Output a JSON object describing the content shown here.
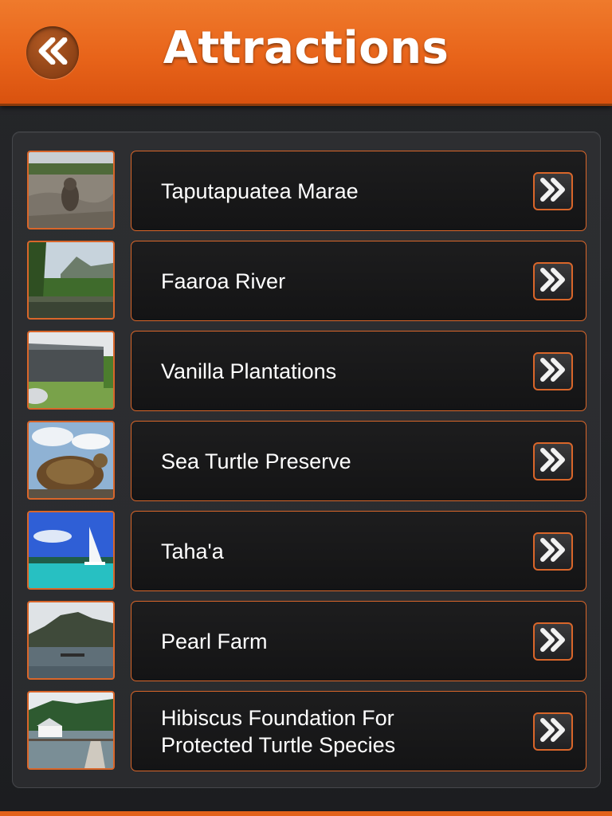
{
  "header": {
    "title": "Attractions",
    "back_icon": "double-chevron-left-icon"
  },
  "colors": {
    "accent": "#e8641a",
    "row_border": "#d9662a",
    "background": "#26272a"
  },
  "items": [
    {
      "label": "Taputapuatea Marae",
      "thumb": "stone-tiki-photo"
    },
    {
      "label": "Faaroa River",
      "thumb": "river-mountain-photo"
    },
    {
      "label": "Vanilla Plantations",
      "thumb": "shade-house-photo"
    },
    {
      "label": "Sea Turtle Preserve",
      "thumb": "sea-turtle-photo"
    },
    {
      "label": "Taha'a",
      "thumb": "lagoon-sailboat-photo"
    },
    {
      "label": "Pearl Farm",
      "thumb": "pearl-farm-photo"
    },
    {
      "label": "Hibiscus Foundation For\nProtected Turtle Species",
      "thumb": "overwater-dock-photo"
    }
  ],
  "row_icon": "double-chevron-right-icon"
}
